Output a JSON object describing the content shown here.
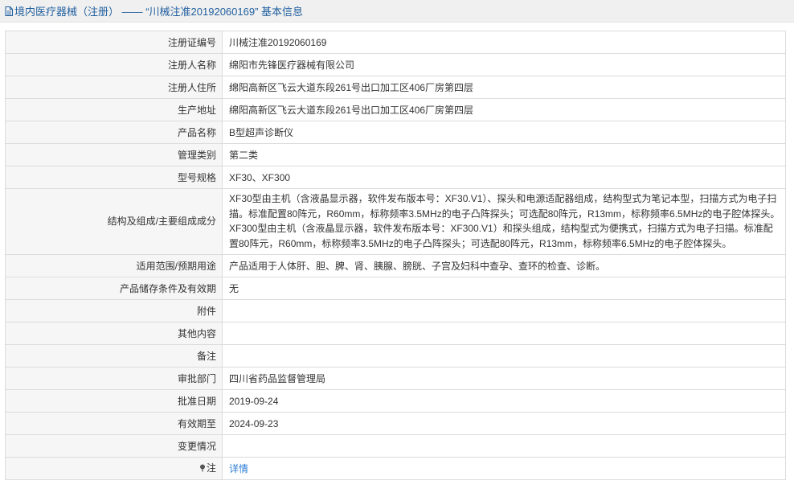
{
  "header": {
    "title": "境内医疗器械（注册） —— “川械注准20192060169” 基本信息"
  },
  "rows": [
    {
      "label": "注册证编号",
      "value": "川械注准20192060169"
    },
    {
      "label": "注册人名称",
      "value": "绵阳市先锋医疗器械有限公司"
    },
    {
      "label": "注册人住所",
      "value": "绵阳高新区飞云大道东段261号出口加工区406厂房第四层"
    },
    {
      "label": "生产地址",
      "value": "绵阳高新区飞云大道东段261号出口加工区406厂房第四层"
    },
    {
      "label": "产品名称",
      "value": "B型超声诊断仪"
    },
    {
      "label": "管理类别",
      "value": "第二类"
    },
    {
      "label": "型号规格",
      "value": "XF30、XF300"
    },
    {
      "label": "结构及组成/主要组成成分",
      "value": "XF30型由主机（含液晶显示器，软件发布版本号：XF30.V1）、探头和电源适配器组成，结构型式为笔记本型，扫描方式为电子扫描。标准配置80阵元，R60mm，标称频率3.5MHz的电子凸阵探头；可选配80阵元，R13mm，标称频率6.5MHz的电子腔体探头。XF300型由主机（含液晶显示器，软件发布版本号：XF300.V1）和探头组成，结构型式为便携式，扫描方式为电子扫描。标准配置80阵元，R60mm，标称频率3.5MHz的电子凸阵探头；可选配80阵元，R13mm，标称频率6.5MHz的电子腔体探头。"
    },
    {
      "label": "适用范围/预期用途",
      "value": "产品适用于人体肝、胆、脾、肾、胰腺、膀胱、子宫及妇科中查孕、查环的检查、诊断。"
    },
    {
      "label": "产品储存条件及有效期",
      "value": "无"
    },
    {
      "label": "附件",
      "value": ""
    },
    {
      "label": "其他内容",
      "value": ""
    },
    {
      "label": "备注",
      "value": ""
    },
    {
      "label": "审批部门",
      "value": "四川省药品监督管理局"
    },
    {
      "label": "批准日期",
      "value": "2019-09-24"
    },
    {
      "label": "有效期至",
      "value": "2024-09-23"
    },
    {
      "label": "变更情况",
      "value": ""
    }
  ],
  "note": {
    "label": "注",
    "link_text": "详情"
  },
  "colors": {
    "header_text": "#1f5e9e",
    "link": "#2c7ed6",
    "label_bg": "#f6f6f6",
    "border": "#dcdcdc"
  }
}
